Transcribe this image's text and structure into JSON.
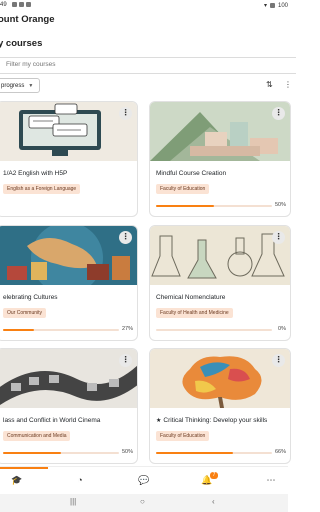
{
  "status_bar": {
    "time": "49",
    "battery": "100"
  },
  "app": {
    "title": "ount Orange"
  },
  "page": {
    "title": "y courses"
  },
  "search": {
    "placeholder": "Filter my courses",
    "value": ""
  },
  "filter": {
    "selected": "progress"
  },
  "icons": {
    "sort": "sort-icon",
    "more": "more-vertical-icon",
    "nav": [
      "graduation-cap-icon",
      "dashboard-icon",
      "chat-icon",
      "bell-icon",
      "more-horizontal-icon"
    ]
  },
  "notifications": {
    "count": "7"
  },
  "accent_color": "#f98012",
  "courses": [
    {
      "title": "1/A2 English with H5P",
      "category": "English as a Foreign Language",
      "progress": null,
      "progress_text": ""
    },
    {
      "title": "Mindful Course Creation",
      "category": "Faculty of Education",
      "progress": 0.5,
      "progress_text": "50%"
    },
    {
      "title": "elebrating Cultures",
      "category": "Our Community",
      "progress": 0.27,
      "progress_text": "27%"
    },
    {
      "title": "Chemical Nomenclature",
      "category": "Faculty of Health and Medicine",
      "progress": 0,
      "progress_text": "0%"
    },
    {
      "title": "lass and Conflict in World Cinema",
      "category": "Communication and Media",
      "progress": 0.5,
      "progress_text": "50%"
    },
    {
      "title": "Critical Thinking: Develop your skills",
      "category": "Faculty of Education",
      "progress": 0.66,
      "progress_text": "66%",
      "starred": true
    }
  ]
}
